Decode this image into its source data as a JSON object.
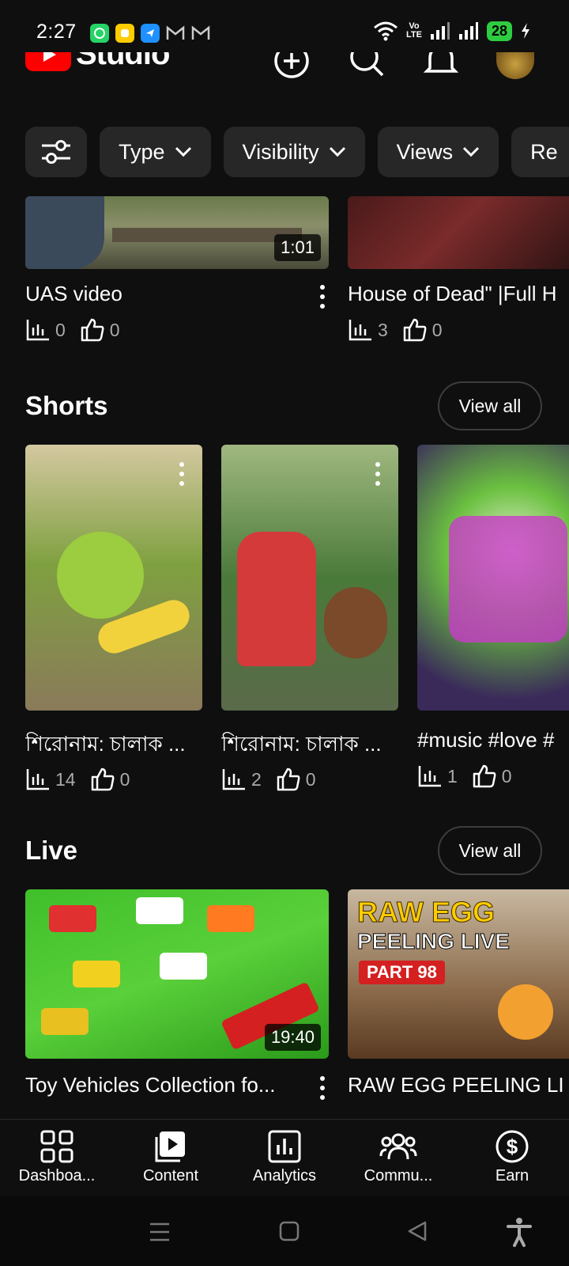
{
  "status_bar": {
    "time": "2:27",
    "battery": "28",
    "network_top": "Vo",
    "network_bottom": "LTE"
  },
  "app": {
    "logo_text": "Studio",
    "icons": [
      "create-icon",
      "search-icon",
      "notifications-icon",
      "channel-avatar"
    ]
  },
  "filters": {
    "chips": [
      {
        "label": "Type"
      },
      {
        "label": "Visibility"
      },
      {
        "label": "Views"
      },
      {
        "label": "Re"
      }
    ]
  },
  "videos": [
    {
      "title": "UAS  video",
      "duration": "1:01",
      "views": "0",
      "likes": "0"
    },
    {
      "title": "House of Dead\" |Full H",
      "views": "3",
      "likes": "0"
    }
  ],
  "shorts": {
    "title": "Shorts",
    "view_all": "View all",
    "items": [
      {
        "title": "শিরোনাম: চালাক ...",
        "views": "14",
        "likes": "0"
      },
      {
        "title": "শিরোনাম: চালাক ...",
        "views": "2",
        "likes": "0"
      },
      {
        "title": "#music #love #",
        "views": "1",
        "likes": "0"
      }
    ]
  },
  "live": {
    "title": "Live",
    "view_all": "View all",
    "items": [
      {
        "title": "Toy Vehicles Collection fo...",
        "duration": "19:40"
      },
      {
        "title": "RAW EGG PEELING LI",
        "thumb_line1": "RAW EGG",
        "thumb_line2": "PEELING LIVE",
        "thumb_line3": "PART 98"
      }
    ]
  },
  "bottom_nav": {
    "items": [
      {
        "label": "Dashboa..."
      },
      {
        "label": "Content"
      },
      {
        "label": "Analytics"
      },
      {
        "label": "Commu..."
      },
      {
        "label": "Earn"
      }
    ]
  },
  "colors": {
    "background": "#0f0f0f",
    "chip": "#272727",
    "accent_red": "#ff0000",
    "battery": "#2ecc40"
  }
}
